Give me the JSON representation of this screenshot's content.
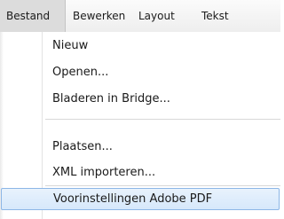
{
  "menubar": {
    "items": [
      {
        "label": "Bestand"
      },
      {
        "label": "Bewerken"
      },
      {
        "label": "Layout"
      },
      {
        "label": "Tekst"
      }
    ]
  },
  "menu": {
    "items": [
      {
        "label": "Nieuw"
      },
      {
        "label": "Openen..."
      },
      {
        "label": "Bladeren in Bridge..."
      },
      {
        "label": "Plaatsen..."
      },
      {
        "label": "XML importeren..."
      },
      {
        "label": "Voorinstellingen Adobe PDF"
      }
    ]
  },
  "colors": {
    "highlight_border": "#8cb6e6",
    "highlight_fill": "#d6e8fb",
    "active_menubar_item": "#dcdcdc"
  }
}
